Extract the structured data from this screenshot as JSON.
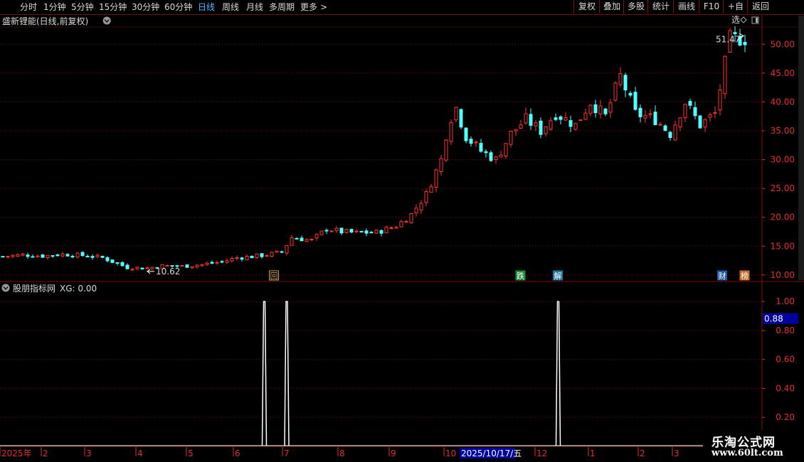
{
  "toolbar": {
    "periods": [
      "分时",
      "1分钟",
      "5分钟",
      "15分钟",
      "30分钟",
      "60分钟",
      "日线",
      "周线",
      "月线",
      "多周期",
      "更多"
    ],
    "active_period": "日线",
    "more_arrow": ">",
    "right_buttons": [
      "复权",
      "叠加",
      "多股",
      "统计",
      "画线",
      "F10",
      "+自选",
      "返回"
    ]
  },
  "main_panel": {
    "title": "盛新锂能(日线,前复权)",
    "max_label": "51.47",
    "min_label": "10.62"
  },
  "event_markers": [
    {
      "text": "回",
      "color": "#c8a05a"
    },
    {
      "text": "跌",
      "color": "#1e8c3a"
    },
    {
      "text": "解",
      "color": "#1e7a9c"
    },
    {
      "text": "财",
      "color": "#1e5aa8"
    },
    {
      "text": "榜",
      "color": "#c86a28"
    }
  ],
  "indicator_panel": {
    "title": "股朋指标网",
    "value_label": "XG: 0.00",
    "current_value_label": "0.88",
    "current_value": 0.88
  },
  "date_axis": {
    "labels": [
      "2025年",
      "2",
      "3",
      "4",
      "5",
      "6",
      "7",
      "8",
      "9",
      "10",
      "12",
      "1",
      "2",
      "3"
    ],
    "cursor_label": "2025/10/17/五"
  },
  "watermark": {
    "line1": "乐淘公式网",
    "line2": "www.60lt.com"
  },
  "colors": {
    "up": "#ff3232",
    "down": "#54ffff",
    "flat": "#ffffff",
    "grid": "#7a1010",
    "axis_text": "#e03030",
    "signal": "#ffffff",
    "cursor_bg": "#0000a0"
  },
  "chart_data": [
    {
      "type": "candlestick",
      "title": "盛新锂能(日线,前复权)",
      "ylim": [
        8.5,
        52.5
      ],
      "y_ticks": [
        10.0,
        15.0,
        20.0,
        25.0,
        30.0,
        35.0,
        40.0,
        45.0,
        50.0
      ],
      "x": [
        "2025-01",
        "2025-02",
        "2025-03",
        "2025-04",
        "2025-05",
        "2025-06",
        "2025-07",
        "2025-08",
        "2025-09",
        "2025-10",
        "2025-11",
        "2025-12",
        "2026-01",
        "2026-02",
        "2026-03"
      ],
      "close_path": [
        [
          0,
          13.2
        ],
        [
          4,
          13.5
        ],
        [
          8,
          13.3
        ],
        [
          12,
          13.6
        ],
        [
          16,
          13.4
        ],
        [
          20,
          13.0
        ],
        [
          25,
          11.3
        ],
        [
          29,
          11.2
        ],
        [
          32,
          11.6
        ],
        [
          36,
          11.5
        ],
        [
          40,
          11.8
        ],
        [
          44,
          12.3
        ],
        [
          47,
          13.0
        ],
        [
          50,
          13.2
        ],
        [
          53,
          13.5
        ],
        [
          56,
          14.0
        ],
        [
          58,
          16.5
        ],
        [
          62,
          16.0
        ],
        [
          65,
          18.0
        ],
        [
          68,
          17.5
        ],
        [
          71,
          17.3
        ],
        [
          75,
          17.4
        ],
        [
          79,
          18.5
        ],
        [
          82,
          20.5
        ],
        [
          85,
          24.0
        ],
        [
          88,
          30.0
        ],
        [
          89.5,
          36.5
        ],
        [
          91,
          39.0
        ],
        [
          93,
          34.0
        ],
        [
          96,
          31.5
        ],
        [
          99,
          30.0
        ],
        [
          102,
          34.5
        ],
        [
          105,
          37.0
        ],
        [
          108,
          35.0
        ],
        [
          111,
          38.0
        ],
        [
          115,
          36.0
        ],
        [
          118,
          40.0
        ],
        [
          121,
          37.5
        ],
        [
          124,
          44.5
        ],
        [
          127,
          38.0
        ],
        [
          131,
          37.0
        ],
        [
          134,
          34.5
        ],
        [
          137,
          40.0
        ],
        [
          140,
          36.0
        ],
        [
          143,
          38.0
        ],
        [
          146,
          51.0
        ]
      ],
      "max": 51.47,
      "min": 10.62
    },
    {
      "type": "line",
      "title": "股朋指标网",
      "series": [
        {
          "name": "XG",
          "last_value": 0.0
        }
      ],
      "ylim": [
        0,
        1.05
      ],
      "y_ticks": [
        0.2,
        0.4,
        0.6,
        0.8,
        1.0
      ],
      "signals_at_days": [
        52.5,
        57.0,
        111.5
      ],
      "signal_value": 1.0
    }
  ]
}
